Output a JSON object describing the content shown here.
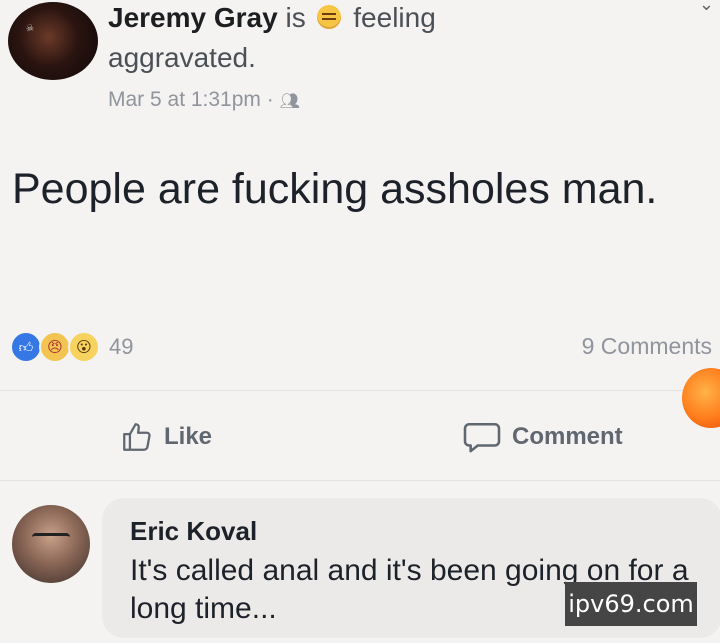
{
  "post": {
    "author": "Jeremy Gray",
    "is_word": "is",
    "feeling_icon": "angry-face-icon",
    "feeling_word": "feeling",
    "feeling_value": "aggravated.",
    "timestamp": "Mar 5 at 1:31pm",
    "separator": "·",
    "audience_icon": "friends-icon",
    "text": "People are fucking assholes man.",
    "reactions": {
      "icons": [
        "like-icon",
        "angry-icon",
        "wow-icon"
      ],
      "count": "49"
    },
    "comments_count": "9 Comments"
  },
  "actions": {
    "like_label": "Like",
    "comment_label": "Comment"
  },
  "comment": {
    "author": "Eric Koval",
    "text": "It's called anal and it's been going on for a long time..."
  },
  "watermark": "ipv69.com",
  "colors": {
    "background": "#f4f3f1",
    "like_blue": "#3578e5",
    "muted_text": "#90949c",
    "comment_bubble": "#eceae8"
  }
}
